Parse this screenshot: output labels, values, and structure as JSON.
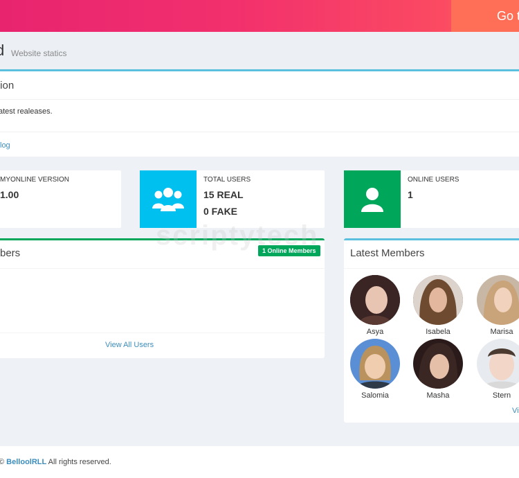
{
  "topbar": {
    "goto_label": "Go t"
  },
  "header": {
    "title": "d",
    "subtitle": "Website statics"
  },
  "info": {
    "title": "tion",
    "text": "atest realeases.",
    "link": "log"
  },
  "stats": [
    {
      "label": "MYONLINE VERSION",
      "value1": "1.00",
      "value2": "",
      "icon": "",
      "color": ""
    },
    {
      "label": "TOTAL USERS",
      "value1": "15 REAL",
      "value2": "0 FAKE",
      "icon": "users-group-icon",
      "color": "#00c0ef"
    },
    {
      "label": "ONLINE USERS",
      "value1": "1",
      "value2": "",
      "icon": "user-icon",
      "color": "#00a65a"
    }
  ],
  "users_panel": {
    "title": "bers",
    "badge": "1 Online Members",
    "view_all": "View All Users"
  },
  "latest": {
    "title": "Latest Members",
    "members": [
      {
        "name": "Asya"
      },
      {
        "name": "Isabela"
      },
      {
        "name": "Marisa"
      },
      {
        "name": "Salomia"
      },
      {
        "name": "Masha"
      },
      {
        "name": "Stern"
      }
    ],
    "more": "Vi"
  },
  "footer": {
    "prefix": "© ",
    "brand": "BelloolRLL",
    "suffix": " All rights reserved."
  },
  "watermark": "scriptytech",
  "colors": {
    "accent_info": "#5bc0de",
    "success": "#00a65a",
    "aqua": "#00c0ef",
    "link": "#3c8dbc"
  }
}
